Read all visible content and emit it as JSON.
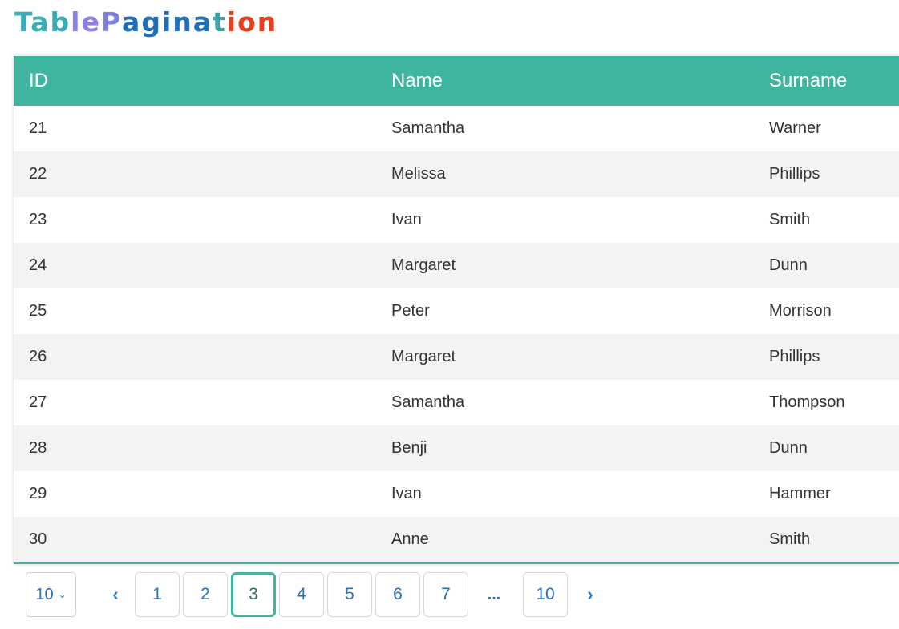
{
  "title": {
    "parts": [
      {
        "text": "Tab",
        "color": "#3aaeb8"
      },
      {
        "text": "le ",
        "color": "#8c82e6"
      },
      {
        "text": "P",
        "color": "#7c7fe0"
      },
      {
        "text": "agina",
        "color": "#1f6fb8"
      },
      {
        "text": "t",
        "color": "#3aa1a4"
      },
      {
        "text": "ion",
        "color": "#e4401f"
      }
    ]
  },
  "colors": {
    "header_bg": "#3fb59f",
    "stripe": "#f3f3f3",
    "link": "#2a6fc0"
  },
  "table": {
    "columns": [
      "ID",
      "Name",
      "Surname"
    ],
    "rows": [
      [
        "21",
        "Samantha",
        "Warner"
      ],
      [
        "22",
        "Melissa",
        "Phillips"
      ],
      [
        "23",
        "Ivan",
        "Smith"
      ],
      [
        "24",
        "Margaret",
        "Dunn"
      ],
      [
        "25",
        "Peter",
        "Morrison"
      ],
      [
        "26",
        "Margaret",
        "Phillips"
      ],
      [
        "27",
        "Samantha",
        "Thompson"
      ],
      [
        "28",
        "Benji",
        "Dunn"
      ],
      [
        "29",
        "Ivan",
        "Hammer"
      ],
      [
        "30",
        "Anne",
        "Smith"
      ]
    ]
  },
  "pagination": {
    "page_size": "10",
    "page_size_icon": "chevron-down-icon",
    "prev_icon": "‹",
    "next_icon": "›",
    "pages": [
      "1",
      "2",
      "3",
      "4",
      "5",
      "6",
      "7"
    ],
    "ellipsis": "...",
    "last_page": "10",
    "current_page": "3"
  }
}
